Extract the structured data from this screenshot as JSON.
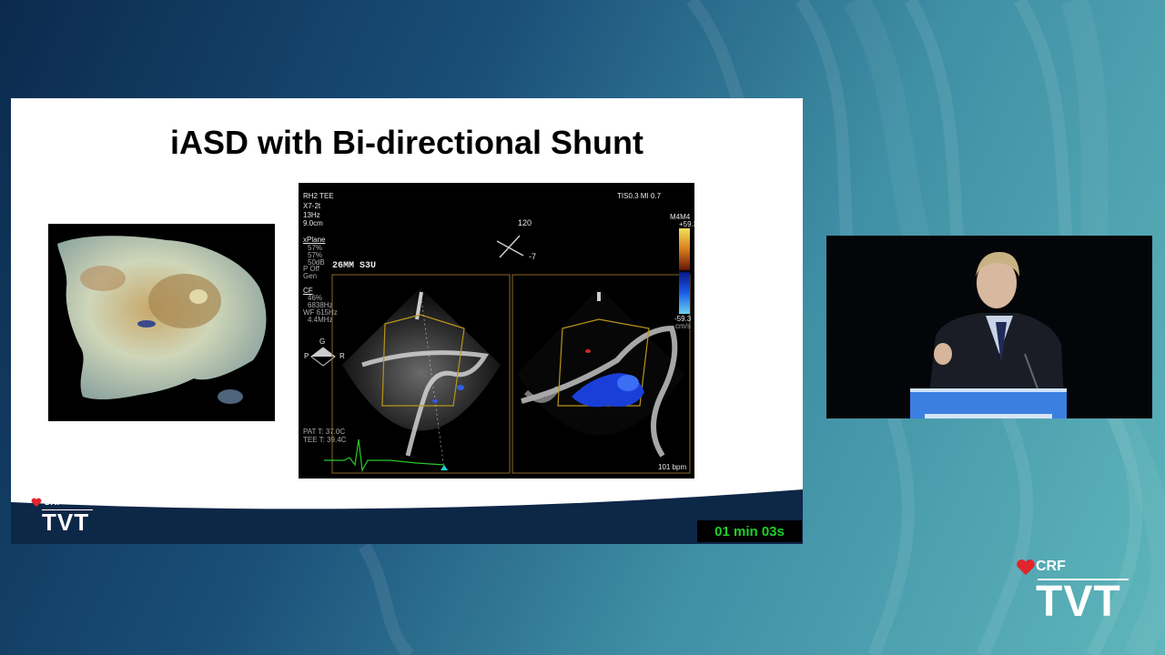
{
  "slide": {
    "title": "iASD with Bi-directional Shunt"
  },
  "echo": {
    "header_left": [
      "RH2 TEE",
      "X7-2t",
      "13Hz",
      "9.0cm"
    ],
    "header_right": "TIS0.3   MI 0.7",
    "xplane_label": "xPlane",
    "xplane_values": [
      "57%",
      "57%",
      "50dB",
      "P Off",
      "Gen"
    ],
    "cf_label": "CF",
    "cf_values": [
      "46%",
      "6838Hz",
      "WF 615Hz",
      "4.4MHz"
    ],
    "probe_label": "26MM S3U",
    "angle_top": "120",
    "angle_right": "-7",
    "scale_label": "M4M4",
    "scale_top": "+59.3",
    "scale_bottom": "-59.3",
    "scale_unit": "cm/s",
    "marker_g": "G",
    "marker_p": "P",
    "marker_r": "R",
    "temp_pat": "PAT T: 37.0C",
    "temp_tee": "TEE T: 39.4C",
    "heart_rate": "101 bpm"
  },
  "branding": {
    "crf": "CRF",
    "tvt": "TVT",
    "accent": "#e2242b"
  },
  "timer": {
    "text": "01 min 03s",
    "color": "#1fcf2b"
  }
}
